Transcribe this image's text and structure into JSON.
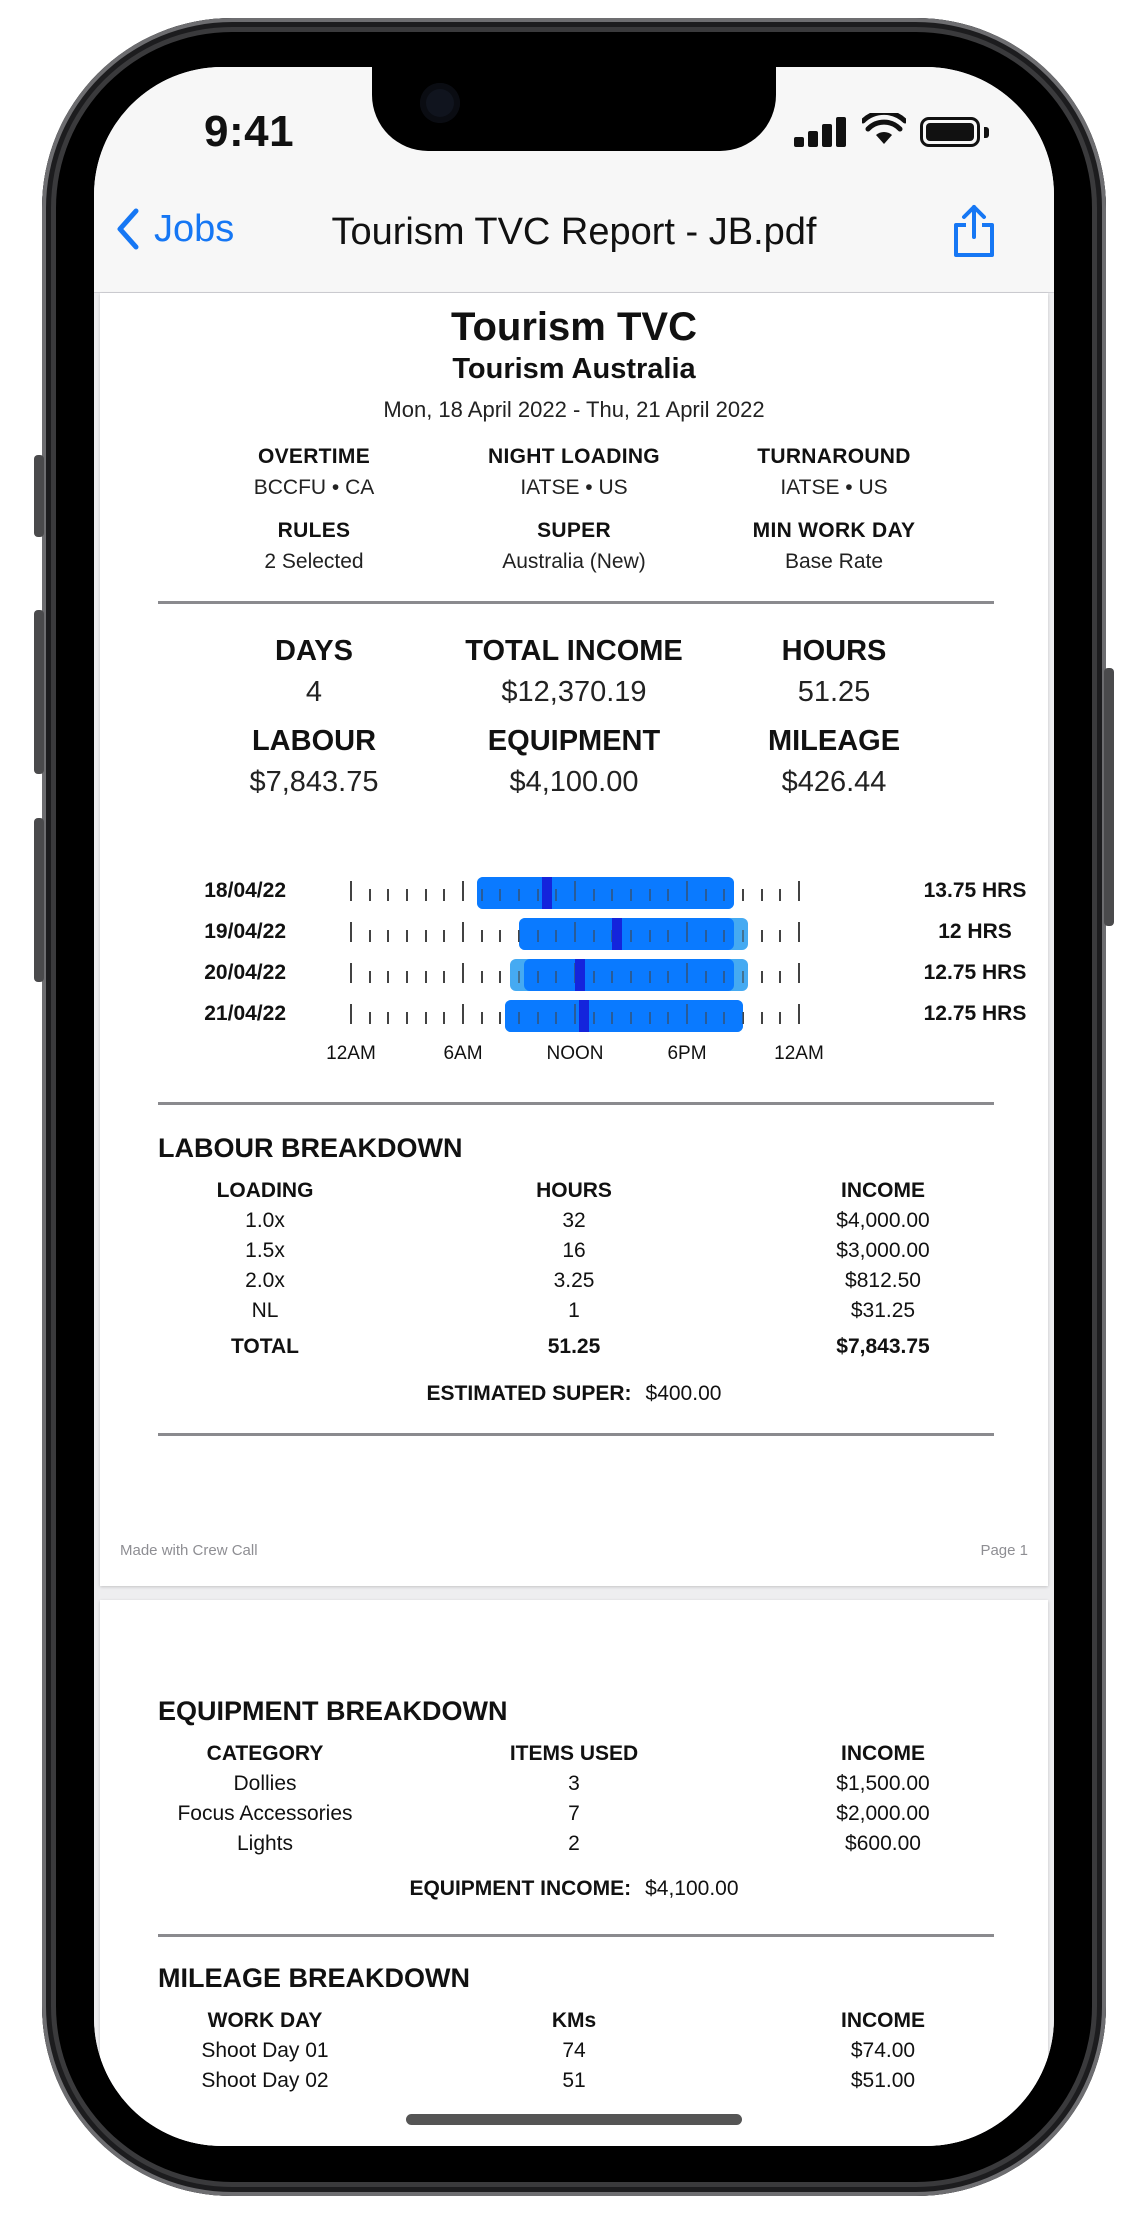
{
  "status": {
    "time": "9:41"
  },
  "nav": {
    "back_label": "Jobs",
    "title": "Tourism TVC Report - JB.pdf",
    "share_icon": "share-icon"
  },
  "report": {
    "title": "Tourism TVC",
    "client": "Tourism Australia",
    "dates": "Mon, 18 April 2022 - Thu, 21 April 2022",
    "settings": [
      {
        "label": "OVERTIME",
        "value": "BCCFU • CA"
      },
      {
        "label": "NIGHT LOADING",
        "value": "IATSE • US"
      },
      {
        "label": "TURNAROUND",
        "value": "IATSE • US"
      },
      {
        "label": "RULES",
        "value": "2 Selected"
      },
      {
        "label": "SUPER",
        "value": "Australia (New)"
      },
      {
        "label": "MIN WORK DAY",
        "value": "Base Rate"
      }
    ],
    "stats": [
      {
        "label": "DAYS",
        "value": "4"
      },
      {
        "label": "TOTAL INCOME",
        "value": "$12,370.19"
      },
      {
        "label": "HOURS",
        "value": "51.25"
      },
      {
        "label": "LABOUR",
        "value": "$7,843.75"
      },
      {
        "label": "EQUIPMENT",
        "value": "$4,100.00"
      },
      {
        "label": "MILEAGE",
        "value": "$426.44"
      }
    ],
    "timeline": {
      "axis_labels": [
        "12AM",
        "6AM",
        "NOON",
        "6PM",
        "12AM"
      ],
      "rows": [
        {
          "date": "18/04/22",
          "hours_label": "13.75 HRS",
          "start": 6.75,
          "end": 20.5,
          "ext_start": 6.75,
          "ext_end": 20.5,
          "marker": 10.5
        },
        {
          "date": "19/04/22",
          "hours_label": "12 HRS",
          "start": 9.0,
          "end": 20.5,
          "ext_start": 9.0,
          "ext_end": 21.25,
          "marker": 14.25
        },
        {
          "date": "20/04/22",
          "hours_label": "12.75 HRS",
          "start": 9.25,
          "end": 20.5,
          "ext_start": 8.5,
          "ext_end": 21.25,
          "marker": 12.25
        },
        {
          "date": "21/04/22",
          "hours_label": "12.75 HRS",
          "start": 8.25,
          "end": 21.0,
          "ext_start": 8.25,
          "ext_end": 21.0,
          "marker": 12.5
        }
      ]
    },
    "labour": {
      "title": "LABOUR BREAKDOWN",
      "headers": [
        "LOADING",
        "HOURS",
        "INCOME"
      ],
      "rows": [
        [
          "1.0x",
          "32",
          "$4,000.00"
        ],
        [
          "1.5x",
          "16",
          "$3,000.00"
        ],
        [
          "2.0x",
          "3.25",
          "$812.50"
        ],
        [
          "NL",
          "1",
          "$31.25"
        ]
      ],
      "total": [
        "TOTAL",
        "51.25",
        "$7,843.75"
      ],
      "summary_label": "ESTIMATED SUPER:",
      "summary_value": "$400.00"
    },
    "footer": {
      "left": "Made with Crew Call",
      "right": "Page 1"
    },
    "equipment": {
      "title": "EQUIPMENT BREAKDOWN",
      "headers": [
        "CATEGORY",
        "ITEMS USED",
        "INCOME"
      ],
      "rows": [
        [
          "Dollies",
          "3",
          "$1,500.00"
        ],
        [
          "Focus Accessories",
          "7",
          "$2,000.00"
        ],
        [
          "Lights",
          "2",
          "$600.00"
        ]
      ],
      "summary_label": "EQUIPMENT INCOME:",
      "summary_value": "$4,100.00"
    },
    "mileage": {
      "title": "MILEAGE BREAKDOWN",
      "headers": [
        "WORK DAY",
        "KMs",
        "INCOME"
      ],
      "rows": [
        [
          "Shoot Day 01",
          "74",
          "$74.00"
        ],
        [
          "Shoot Day 02",
          "51",
          "$51.00"
        ]
      ]
    }
  },
  "colors": {
    "accent": "#1677f4",
    "bar": "#0a7aff",
    "bar_ext": "#45aaf2",
    "marker": "#1424dc"
  }
}
